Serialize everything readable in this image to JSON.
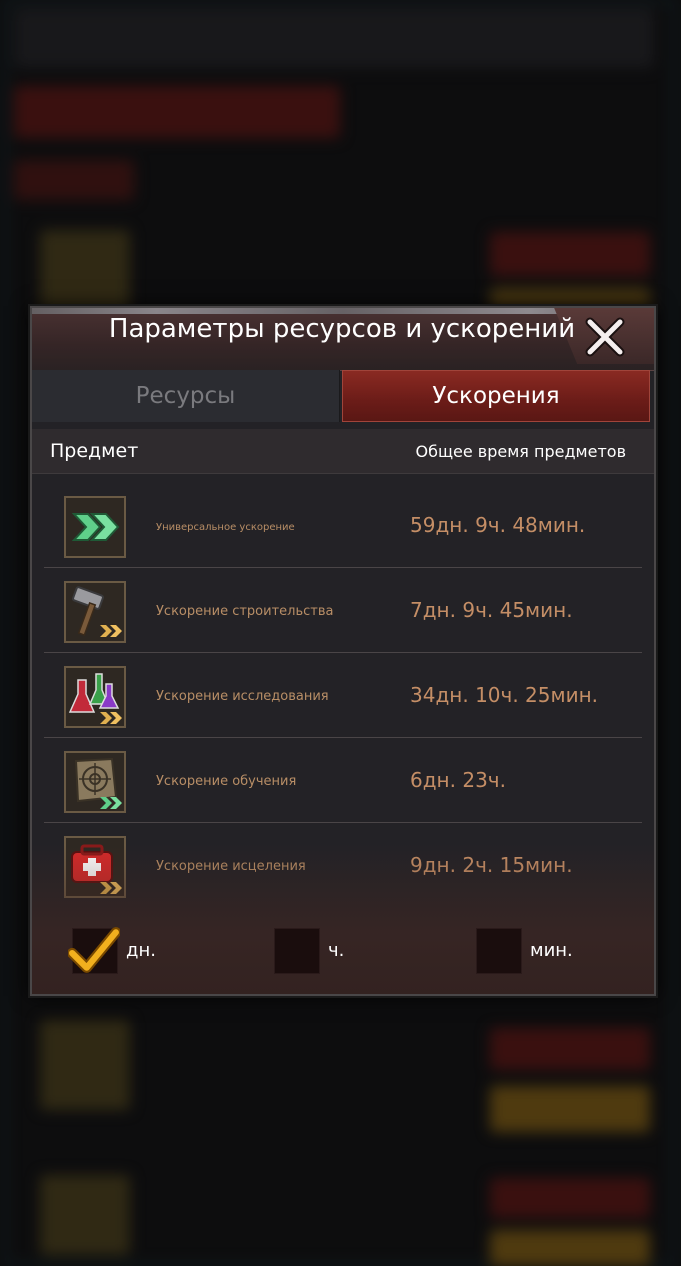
{
  "dialog": {
    "title": "Параметры ресурсов и ускорений",
    "tabs": [
      {
        "label": "Ресурсы",
        "active": false
      },
      {
        "label": "Ускорения",
        "active": true
      }
    ],
    "header": {
      "item_col": "Предмет",
      "time_col": "Общее время предметов"
    },
    "items": [
      {
        "name": "Универсальное ускорение",
        "time": "59дн. 9ч. 48мин.",
        "icon": "speedup-arrows-icon"
      },
      {
        "name": "Ускорение строительства",
        "time": "7дн. 9ч. 45мин.",
        "icon": "hammer-icon"
      },
      {
        "name": "Ускорение исследования",
        "time": "34дн. 10ч. 25мин.",
        "icon": "flask-icon"
      },
      {
        "name": "Ускорение обучения",
        "time": "6дн. 23ч.",
        "icon": "target-icon"
      },
      {
        "name": "Ускорение исцеления",
        "time": "9дн. 2ч. 15мин.",
        "icon": "medkit-icon"
      }
    ],
    "units": [
      {
        "label": "дн.",
        "checked": true
      },
      {
        "label": "ч.",
        "checked": false
      },
      {
        "label": "мин.",
        "checked": false
      }
    ]
  },
  "colors": {
    "accent_red": "#6b1c18",
    "time_text": "#c48e66",
    "check": "#f2b01e"
  }
}
